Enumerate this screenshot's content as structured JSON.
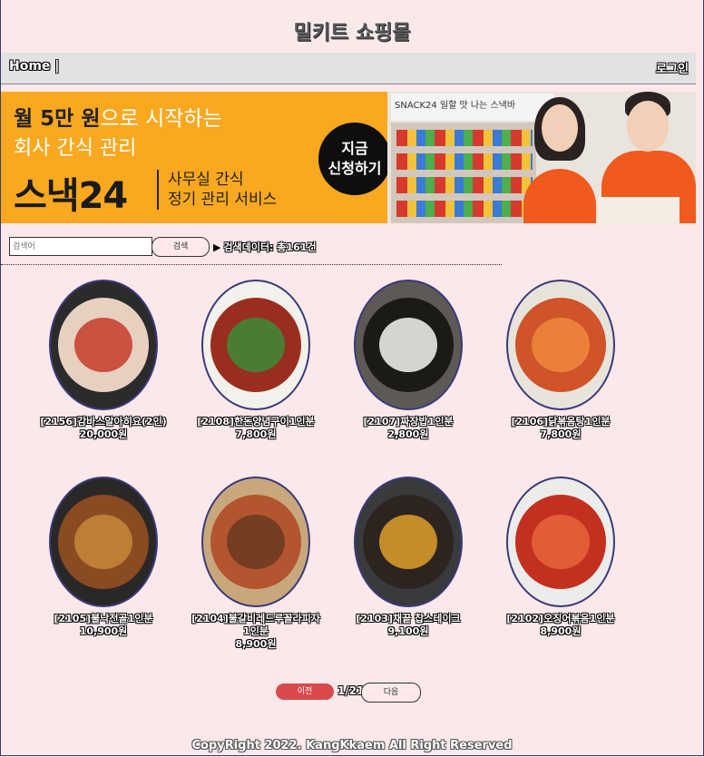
{
  "site": {
    "title": "밀키트 쇼핑몰"
  },
  "nav": {
    "home": "Home |",
    "login": "로그인"
  },
  "banner": {
    "line1_bold": "월 5만 원",
    "line1_rest": "으로 시작하는",
    "line2": "회사 간식 관리",
    "brand": "스낵24",
    "sub1": "사무실 간식",
    "sub2": "정기 관리 서비스",
    "cta1": "지금",
    "cta2": "신청하기",
    "sign": "SNACK24 일할 맛 나는 스낵바"
  },
  "search": {
    "placeholder": "검색어",
    "button": "검색",
    "info": "검색데이터: 총161건"
  },
  "products": [
    {
      "name": "[2156]감바스알아히요(2인)",
      "price": "20,000원",
      "colors": [
        "#2b2b2b",
        "#e8d0c0",
        "#c63b2a"
      ]
    },
    {
      "name": "[2108]한돈양념구이1인분",
      "price": "7,800원",
      "colors": [
        "#f3f1ec",
        "#9a2e1e",
        "#3c8a3a"
      ]
    },
    {
      "name": "[2107]짜장밥1인분",
      "price": "2,800원",
      "colors": [
        "#5d5a55",
        "#1c1a16",
        "#f6f6f2"
      ]
    },
    {
      "name": "[2106]닭볶음탕1인분",
      "price": "7,800원",
      "colors": [
        "#e9e4db",
        "#d0532a",
        "#f08a3c"
      ]
    },
    {
      "name": "[2105]불낙전골1인분",
      "price": "10,900원",
      "colors": [
        "#2a2826",
        "#8a4a22",
        "#c8873a"
      ]
    },
    {
      "name": "[2104]불갈비레드루꼴라피자1인분",
      "price": "8,900원",
      "colors": [
        "#c9a77d",
        "#b3552e",
        "#6a3a1e"
      ]
    },
    {
      "name": "[2103]채끝 찹스테이크",
      "price": "9,100원",
      "colors": [
        "#393a3c",
        "#2d2420",
        "#e0a02a"
      ]
    },
    {
      "name": "[2102]오징어볶음1인분",
      "price": "8,900원",
      "colors": [
        "#ececea",
        "#c4301f",
        "#e7653a"
      ]
    }
  ],
  "pager": {
    "prev": "이전",
    "page": "1/21",
    "next": "다음"
  },
  "footer": "CopyRight 2022. KangKkaem All Right Reserved"
}
